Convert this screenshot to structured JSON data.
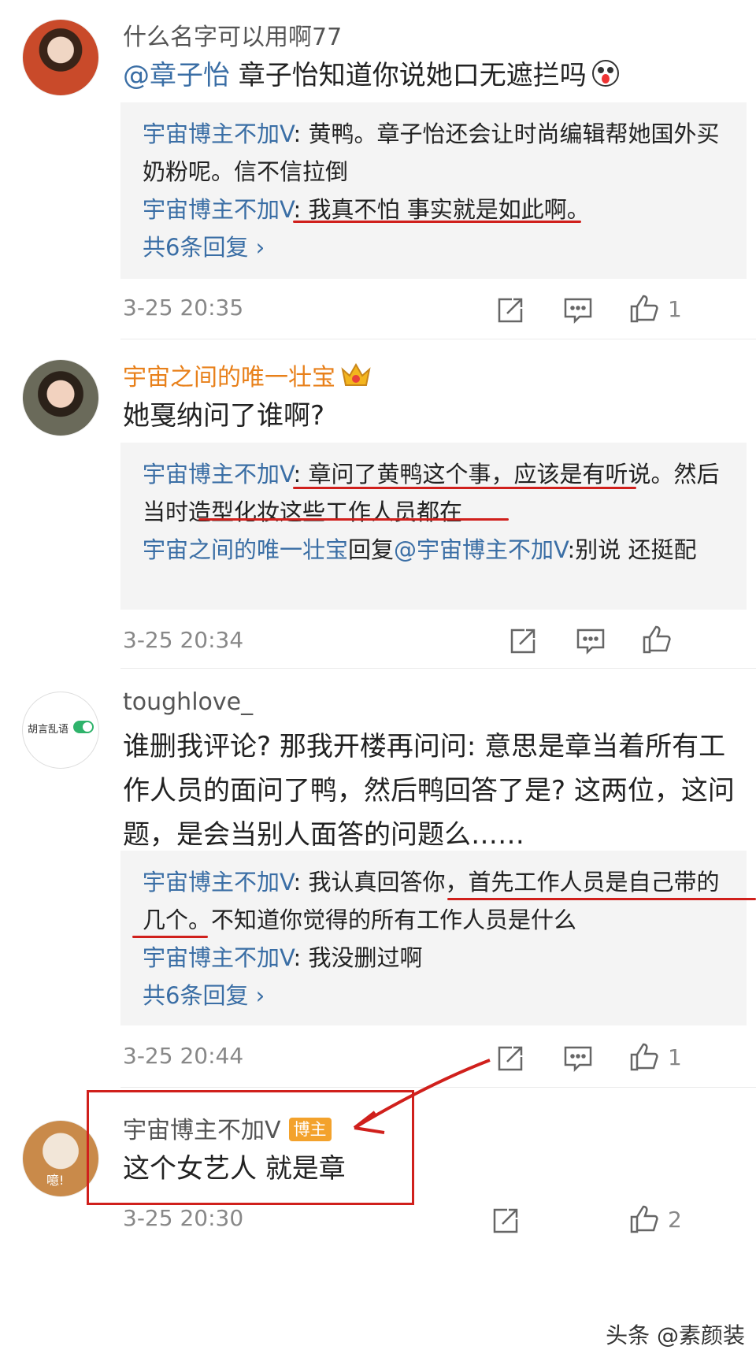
{
  "comments": [
    {
      "username": "什么名字可以用啊77",
      "mention": "@章子怡",
      "text": " 章子怡知道你说她口无遮拦吗",
      "replies": [
        {
          "name": "宇宙博主不加V",
          "sep": ": ",
          "text": "黄鸭。章子怡还会让时尚编辑帮她国外买奶粉呢。信不信拉倒"
        },
        {
          "name": "宇宙博主不加V",
          "sep": ": ",
          "text": "我真不怕 事实就是如此啊。"
        }
      ],
      "more": "共6条回复 ›",
      "time": "3-25 20:35",
      "likes": "1"
    },
    {
      "username": "宇宙之间的唯一壮宝",
      "text": "她戛纳问了谁啊?",
      "replies": [
        {
          "name": "宇宙博主不加V",
          "sep": ": ",
          "text": "章问了黄鸭这个事，应该是有听说。然后当时造型化妆这些工作人员都在"
        },
        {
          "name": "宇宙之间的唯一壮宝",
          "reply_word": "回复",
          "mention": "@宇宙博主不加V",
          "sep": ":",
          "text": "别说 还挺配"
        }
      ],
      "time": "3-25 20:34"
    },
    {
      "username": "toughlove_",
      "avatar_text": "胡言乱语",
      "text": "谁删我评论? 那我开楼再问问: 意思是章当着所有工作人员的面问了鸭，然后鸭回答了是? 这两位，这问题，是会当别人面答的问题么……",
      "replies": [
        {
          "name": "宇宙博主不加V",
          "sep": ": ",
          "text": "我认真回答你，首先工作人员是自己带的几个。不知道你觉得的所有工作人员是什么"
        },
        {
          "name": "宇宙博主不加V",
          "sep": ": ",
          "text": "我没删过啊"
        }
      ],
      "more": "共6条回复 ›",
      "time": "3-25 20:44",
      "likes": "1"
    },
    {
      "username": "宇宙博主不加V",
      "badge": "博主",
      "avatar_text": "噫!",
      "text": "这个女艺人 就是章",
      "time": "3-25 20:30",
      "likes": "2"
    }
  ],
  "watermark": "头条 @素颜装",
  "colors": {
    "link": "#3a6ea5",
    "annotation": "#d0201c",
    "badge": "#f3a22c",
    "vip_name": "#e8801a"
  }
}
